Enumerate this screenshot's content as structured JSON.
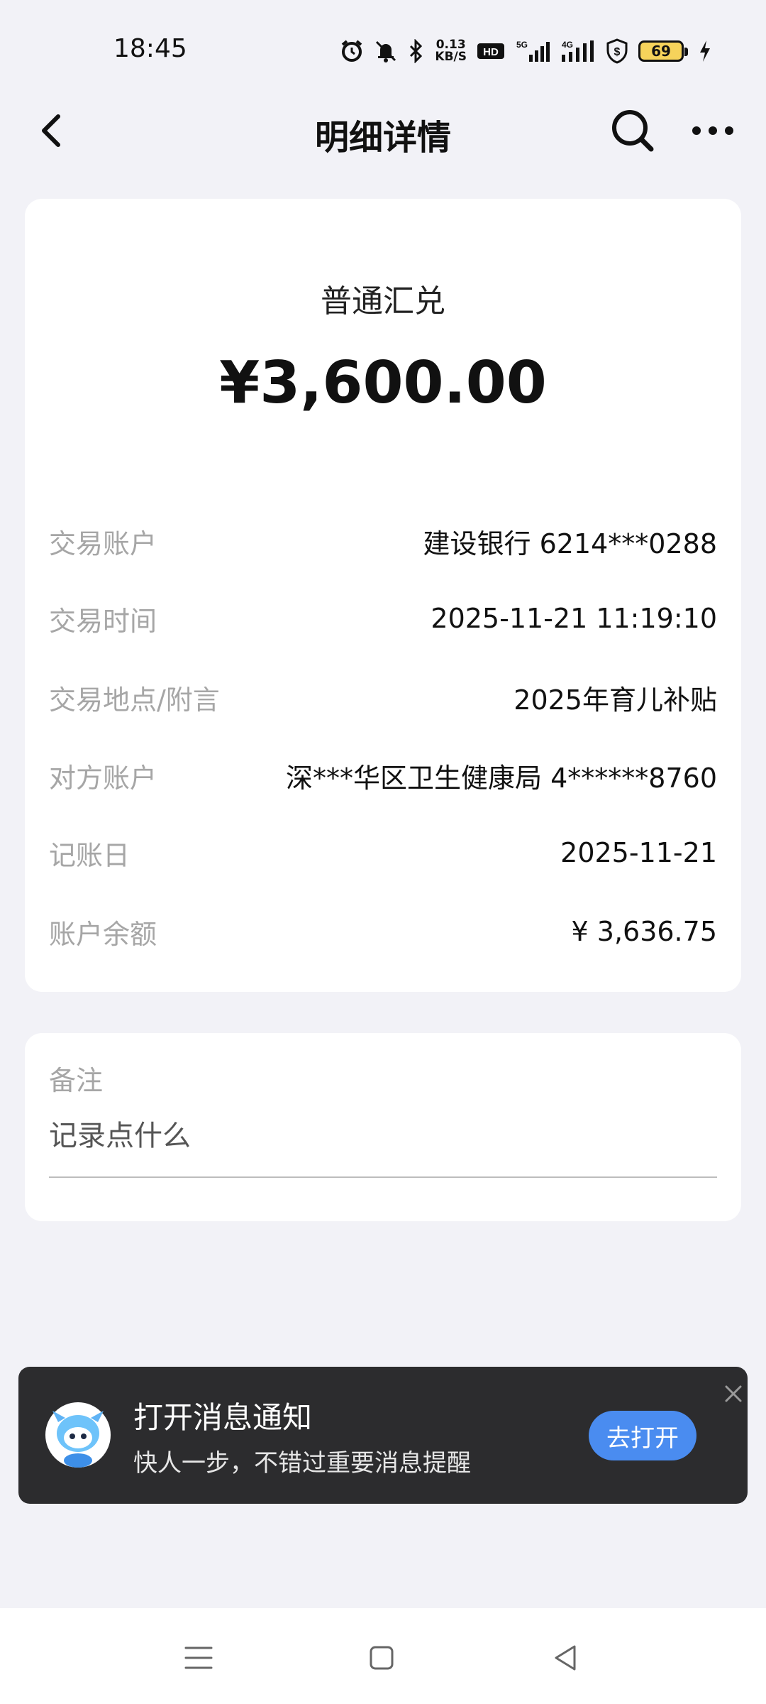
{
  "status_bar": {
    "time": "18:45",
    "net_speed_value": "0.13",
    "net_speed_unit": "KB/S",
    "battery_level": "69",
    "icons": [
      "alarm-icon",
      "mute-icon",
      "bluetooth-icon",
      "hd-icon",
      "5g-signal-icon",
      "4g-signal-icon",
      "shield-icon",
      "battery-icon",
      "charging-icon"
    ]
  },
  "header": {
    "title": "明细详情",
    "icons": [
      "back-arrow-icon",
      "search-icon",
      "more-icon"
    ]
  },
  "transaction": {
    "type": "普通汇兑",
    "amount": "¥3,600.00",
    "rows": [
      {
        "label": "交易账户",
        "value": "建设银行 6214***0288"
      },
      {
        "label": "交易时间",
        "value": "2025-11-21 11:19:10"
      },
      {
        "label": "交易地点/附言",
        "value": "2025年育儿补贴"
      },
      {
        "label": "对方账户",
        "value": "深***华区卫生健康局 4******8760"
      },
      {
        "label": "记账日",
        "value": "2025-11-21"
      },
      {
        "label": "账户余额",
        "value": "¥ 3,636.75"
      }
    ]
  },
  "remark": {
    "label": "备注",
    "placeholder": "记录点什么"
  },
  "notification": {
    "title": "打开消息通知",
    "subtitle": "快人一步，不错过重要消息提醒",
    "button_label": "去打开",
    "button_color": "#4a8cf0"
  },
  "bottom_nav": {
    "icons": [
      "menu-icon",
      "home-square-icon",
      "back-triangle-icon"
    ]
  }
}
